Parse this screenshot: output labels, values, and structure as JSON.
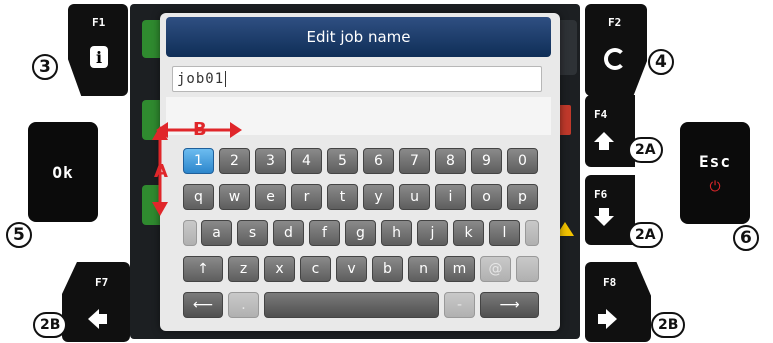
{
  "dialog": {
    "title": "Edit job name",
    "job_name_value": "job01"
  },
  "keyboard": {
    "row1": [
      "1",
      "2",
      "3",
      "4",
      "5",
      "6",
      "7",
      "8",
      "9",
      "0"
    ],
    "row2": [
      "q",
      "w",
      "e",
      "r",
      "t",
      "y",
      "u",
      "i",
      "o",
      "p"
    ],
    "row3": [
      "a",
      "s",
      "d",
      "f",
      "g",
      "h",
      "j",
      "k",
      "l"
    ],
    "row4": [
      "↑",
      "z",
      "x",
      "c",
      "v",
      "b",
      "n",
      "m",
      "@"
    ],
    "row5": {
      "backspace": "⟵",
      "space": "",
      "forward": "⟶",
      "dot": ".",
      "dash": "-"
    }
  },
  "buttons": {
    "f1": {
      "label": "F1",
      "badge": "3"
    },
    "f2": {
      "label": "F2",
      "badge": "4"
    },
    "f4": {
      "label": "F4",
      "badge": "2A"
    },
    "f6": {
      "label": "F6",
      "badge": "2A"
    },
    "f7": {
      "label": "F7",
      "badge": "2B"
    },
    "f8": {
      "label": "F8",
      "badge": "2B"
    },
    "ok": {
      "label": "Ok",
      "badge": "5"
    },
    "esc": {
      "label": "Esc",
      "badge": "6"
    }
  },
  "annotations": {
    "a": "A",
    "b": "B"
  },
  "colors": {
    "accent_red": "#e0262a",
    "title_blue": "#1f3f6f",
    "selected_key": "#3b9be0"
  }
}
